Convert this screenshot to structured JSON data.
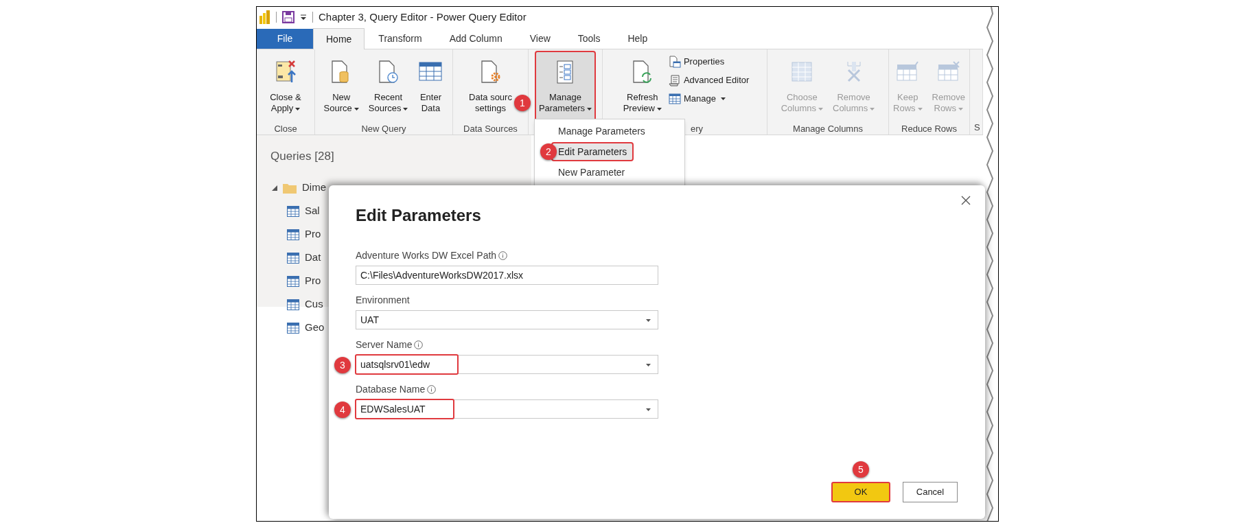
{
  "window": {
    "title": "Chapter 3, Query Editor - Power Query Editor"
  },
  "ribbon_tabs": [
    {
      "label": "File",
      "kind": "file",
      "selected": false
    },
    {
      "label": "Home",
      "kind": "tab",
      "selected": true
    },
    {
      "label": "Transform",
      "kind": "tab",
      "selected": false
    },
    {
      "label": "Add Column",
      "kind": "tab",
      "selected": false
    },
    {
      "label": "View",
      "kind": "tab",
      "selected": false
    },
    {
      "label": "Tools",
      "kind": "tab",
      "selected": false
    },
    {
      "label": "Help",
      "kind": "tab",
      "selected": false
    }
  ],
  "ribbon_groups": [
    {
      "label": "Close",
      "buttons": [
        {
          "kind": "large",
          "lines": [
            "Close &",
            "Apply"
          ],
          "dropdown": true,
          "disabled": false
        }
      ]
    },
    {
      "label": "New Query",
      "buttons": [
        {
          "kind": "large",
          "lines": [
            "New",
            "Source"
          ],
          "dropdown": true,
          "disabled": false
        },
        {
          "kind": "large",
          "lines": [
            "Recent",
            "Sources"
          ],
          "dropdown": true,
          "disabled": false
        },
        {
          "kind": "large",
          "lines": [
            "Enter",
            "Data"
          ],
          "dropdown": false,
          "disabled": false
        }
      ]
    },
    {
      "label": "Data Sources",
      "buttons": [
        {
          "kind": "large",
          "lines": [
            "Data sourc",
            "settings"
          ],
          "dropdown": false,
          "disabled": false
        }
      ]
    },
    {
      "buttons": [
        {
          "kind": "large",
          "lines": [
            "Manage",
            "Parameters"
          ],
          "dropdown": true,
          "disabled": false,
          "highlighted": true,
          "badge": "1"
        }
      ]
    },
    {
      "label": "ery",
      "buttons": [
        {
          "kind": "large",
          "lines": [
            "Refresh",
            "Preview"
          ],
          "dropdown": true,
          "disabled": false
        },
        {
          "kind": "small",
          "lines": [
            "Properties"
          ],
          "dropdown": false,
          "disabled": false
        },
        {
          "kind": "small",
          "lines": [
            "Advanced Editor"
          ],
          "dropdown": false,
          "disabled": false
        },
        {
          "kind": "small",
          "lines": [
            "Manage"
          ],
          "dropdown": true,
          "disabled": false
        }
      ]
    },
    {
      "label": "Manage Columns",
      "buttons": [
        {
          "kind": "large",
          "lines": [
            "Choose",
            "Columns"
          ],
          "dropdown": true,
          "disabled": true
        },
        {
          "kind": "large",
          "lines": [
            "Remove",
            "Columns"
          ],
          "dropdown": true,
          "disabled": true
        }
      ]
    },
    {
      "label": "Reduce Rows",
      "buttons": [
        {
          "kind": "large",
          "lines": [
            "Keep",
            "Rows"
          ],
          "dropdown": true,
          "disabled": true
        },
        {
          "kind": "large",
          "lines": [
            "Remove",
            "Rows"
          ],
          "dropdown": true,
          "disabled": true
        }
      ]
    },
    {
      "label": "S"
    }
  ],
  "parameters_menu": [
    {
      "label": "Manage Parameters",
      "hovered": false,
      "highlighted": false
    },
    {
      "label": "Edit Parameters",
      "hovered": true,
      "highlighted": true,
      "badge": "2"
    },
    {
      "label": "New Parameter",
      "hovered": false,
      "highlighted": false
    }
  ],
  "queries_pane": {
    "title": "Queries [28]",
    "tree": [
      {
        "label": "Dime",
        "expanded": true,
        "children": [
          {
            "label": "Sal"
          },
          {
            "label": "Pro"
          },
          {
            "label": "Dat"
          },
          {
            "label": "Pro"
          },
          {
            "label": "Cus"
          },
          {
            "label": "Geo"
          }
        ]
      }
    ]
  },
  "dialog": {
    "title": "Edit Parameters",
    "fields": [
      {
        "label": "Adventure Works DW Excel Path",
        "info_icon": true,
        "kind": "text",
        "value": "C:\\Files\\AdventureWorksDW2017.xlsx",
        "highlighted": false
      },
      {
        "label": "Environment",
        "info_icon": false,
        "kind": "select",
        "value": "UAT",
        "highlighted": false
      },
      {
        "label": "Server Name",
        "info_icon": true,
        "kind": "select",
        "value": "uatsqlsrv01\\edw",
        "highlighted": true,
        "badge": "3"
      },
      {
        "label": "Database Name",
        "info_icon": true,
        "kind": "select",
        "value": "EDWSalesUAT",
        "highlighted": true,
        "badge": "4"
      }
    ],
    "buttons": [
      {
        "label": "OK",
        "primary": true,
        "highlighted": true,
        "badge": "5"
      },
      {
        "label": "Cancel",
        "primary": false,
        "highlighted": false
      }
    ]
  }
}
